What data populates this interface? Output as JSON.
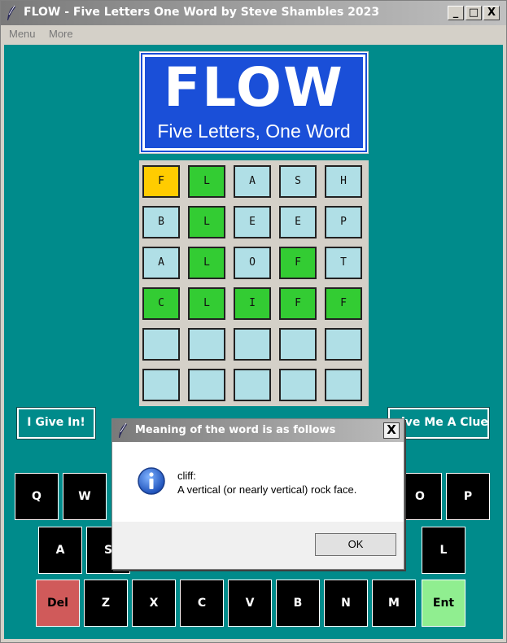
{
  "window": {
    "title": "FLOW - Five Letters One Word by Steve Shambles 2023",
    "controls": {
      "minimize": "_",
      "maximize": "□",
      "close": "X"
    }
  },
  "menu": {
    "items": [
      "Menu",
      "More"
    ]
  },
  "logo": {
    "big": "FLOW",
    "small": "Five Letters, One Word"
  },
  "grid": {
    "rows": [
      [
        {
          "l": "F",
          "s": "yellow"
        },
        {
          "l": "L",
          "s": "green"
        },
        {
          "l": "A",
          "s": "none"
        },
        {
          "l": "S",
          "s": "none"
        },
        {
          "l": "H",
          "s": "none"
        }
      ],
      [
        {
          "l": "B",
          "s": "none"
        },
        {
          "l": "L",
          "s": "green"
        },
        {
          "l": "E",
          "s": "none"
        },
        {
          "l": "E",
          "s": "none"
        },
        {
          "l": "P",
          "s": "none"
        }
      ],
      [
        {
          "l": "A",
          "s": "none"
        },
        {
          "l": "L",
          "s": "green"
        },
        {
          "l": "O",
          "s": "none"
        },
        {
          "l": "F",
          "s": "green"
        },
        {
          "l": "T",
          "s": "none"
        }
      ],
      [
        {
          "l": "C",
          "s": "green"
        },
        {
          "l": "L",
          "s": "green"
        },
        {
          "l": "I",
          "s": "green"
        },
        {
          "l": "F",
          "s": "green"
        },
        {
          "l": "F",
          "s": "green"
        }
      ],
      [
        {
          "l": "",
          "s": "none"
        },
        {
          "l": "",
          "s": "none"
        },
        {
          "l": "",
          "s": "none"
        },
        {
          "l": "",
          "s": "none"
        },
        {
          "l": "",
          "s": "none"
        }
      ],
      [
        {
          "l": "",
          "s": "none"
        },
        {
          "l": "",
          "s": "none"
        },
        {
          "l": "",
          "s": "none"
        },
        {
          "l": "",
          "s": "none"
        },
        {
          "l": "",
          "s": "none"
        }
      ]
    ]
  },
  "buttons": {
    "give_in": "I Give In!",
    "clue": "ive Me A Clue"
  },
  "keyboard": {
    "row1_visible": [
      "Q",
      "W",
      "O",
      "P"
    ],
    "row2_visible": [
      "A",
      "S",
      "L"
    ],
    "row3": [
      "Del",
      "Z",
      "X",
      "C",
      "V",
      "B",
      "N",
      "M",
      "Ent"
    ]
  },
  "dialog": {
    "title": "Meaning of the word is as follows",
    "close": "X",
    "word": "cliff:",
    "definition": "A vertical (or nearly vertical) rock face.",
    "ok": "OK"
  },
  "colors": {
    "background": "#008b8b",
    "correct": "#33cc33",
    "present": "#ffcc00",
    "empty": "#b0dfe6",
    "delete_key": "#d05a5a",
    "enter_key": "#90ee90"
  }
}
